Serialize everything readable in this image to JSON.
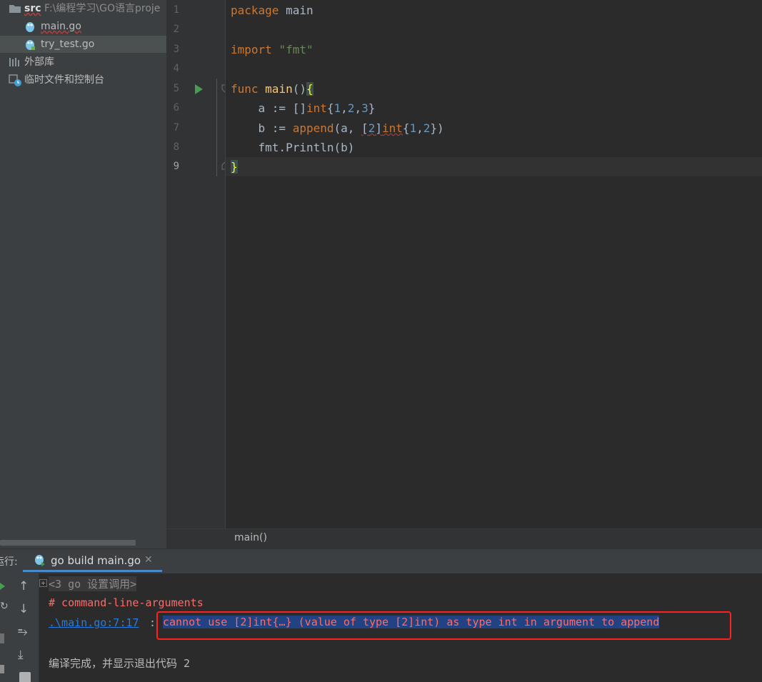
{
  "project_tree": {
    "src_label": "src",
    "src_path": "F:\\编程学习\\GO语言proje",
    "files": [
      "main.go",
      "try_test.go"
    ],
    "external_libs": "外部库",
    "scratches": "临时文件和控制台"
  },
  "editor": {
    "line_numbers": [
      "1",
      "2",
      "3",
      "4",
      "5",
      "6",
      "7",
      "8",
      "9"
    ],
    "breadcrumb": "main()"
  },
  "run_panel": {
    "label": "运行:",
    "tab_title": "go build main.go",
    "collapsed_line": "<3 go 设置调用>",
    "error_header": "# command-line-arguments",
    "error_link": ".\\main.go:7:17",
    "error_sep": ":",
    "error_message": "cannot use [2]int{…} (value of type [2]int) as type int in argument to append",
    "exit_message": "编译完成，并显示退出代码 2"
  },
  "colors": {
    "keyword": "#cc7832",
    "string": "#6a8759",
    "number": "#6897bb",
    "error_text": "#ff6b68",
    "link": "#287bde",
    "highlight_box": "#ff2020"
  }
}
